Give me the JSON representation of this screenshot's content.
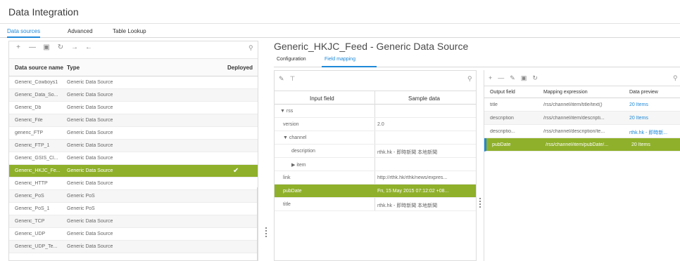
{
  "app": {
    "title": "Data Integration"
  },
  "tabs": [
    {
      "label": "Data sources",
      "active": true
    },
    {
      "label": "Advanced",
      "active": false
    },
    {
      "label": "Table Lookup",
      "active": false
    }
  ],
  "left_toolbar": {
    "icons": [
      "plus-icon",
      "minus-icon",
      "folder-icon",
      "refresh-icon",
      "import-icon",
      "export-icon"
    ],
    "glyphs": [
      "+",
      "—",
      "▣",
      "↻",
      "→",
      "←"
    ]
  },
  "data_sources": {
    "columns": [
      "Data source name",
      "Type",
      "Deployed"
    ],
    "rows": [
      {
        "name": "Generic_Cowboys1",
        "type": "Generic Data Source",
        "deployed": ""
      },
      {
        "name": "Generic_Data_So...",
        "type": "Generic Data Source",
        "deployed": ""
      },
      {
        "name": "Generic_Db",
        "type": "Generic Data Source",
        "deployed": ""
      },
      {
        "name": "Generic_File",
        "type": "Generic Data Source",
        "deployed": ""
      },
      {
        "name": "generic_FTP",
        "type": "Generic Data Source",
        "deployed": ""
      },
      {
        "name": "Generic_FTP_1",
        "type": "Generic Data Source",
        "deployed": ""
      },
      {
        "name": "Generic_GSIS_Cl...",
        "type": "Generic Data Source",
        "deployed": ""
      },
      {
        "name": "Generic_HKJC_Fe...",
        "type": "Generic Data Source",
        "deployed": "✔",
        "selected": true
      },
      {
        "name": "Generic_HTTP",
        "type": "Generic Data Source",
        "deployed": ""
      },
      {
        "name": "Generic_PoS",
        "type": "Generic PoS",
        "deployed": ""
      },
      {
        "name": "Generic_PoS_1",
        "type": "Generic PoS",
        "deployed": ""
      },
      {
        "name": "Generic_TCP",
        "type": "Generic Data Source",
        "deployed": ""
      },
      {
        "name": "Generic_UDP",
        "type": "Generic Data Source",
        "deployed": ""
      },
      {
        "name": "Generic_UDP_Te...",
        "type": "Generic Data Source",
        "deployed": ""
      }
    ]
  },
  "detail": {
    "title": "Generic_HKJC_Feed - Generic Data Source",
    "subtabs": [
      {
        "label": "Configuration",
        "active": false
      },
      {
        "label": "Field mapping",
        "active": true
      }
    ]
  },
  "input_fields": {
    "columns": [
      "Input field",
      "Sample data"
    ],
    "rows": [
      {
        "field": "▼ rss",
        "sample": "",
        "indent": 0
      },
      {
        "field": "version",
        "sample": "2.0",
        "indent": 1
      },
      {
        "field": "▼ channel",
        "sample": "",
        "indent": 1
      },
      {
        "field": "description",
        "sample": "rthk.hk - 即時新聞 本地新聞",
        "indent": 2
      },
      {
        "field": "▶ item",
        "sample": "",
        "indent": 2
      },
      {
        "field": "link",
        "sample": "http://rthk.hk/rthk/news/expres...",
        "indent": 1
      },
      {
        "field": "pubDate",
        "sample": "Fri, 15 May 2015 07:12:02 +08...",
        "indent": 1,
        "selected": true
      },
      {
        "field": "title",
        "sample": "rthk.hk - 即時新聞 本地新聞",
        "indent": 1
      }
    ]
  },
  "output_fields": {
    "columns": [
      "Output field",
      "Mapping expression",
      "Data preview"
    ],
    "rows": [
      {
        "field": "title",
        "expr": "/rss/channel/item/title/text()",
        "preview": "20 Items"
      },
      {
        "field": "description",
        "expr": "/rss/channel/item/descripti...",
        "preview": "20 Items"
      },
      {
        "field": "descriptio...",
        "expr": "/rss/channel/description/te...",
        "preview": "rthk.hk - 即時新..."
      },
      {
        "field": "pubDate",
        "expr": "/rss/channel/item/pubDate/...",
        "preview": "20 Items",
        "selected": true
      }
    ]
  },
  "colors": {
    "accent": "#1e88d8",
    "selection": "#8fb02a"
  }
}
